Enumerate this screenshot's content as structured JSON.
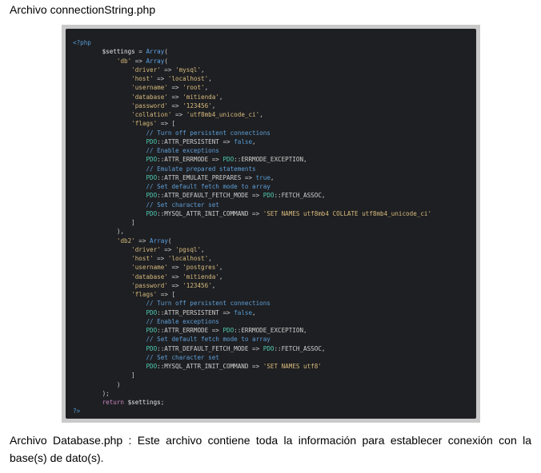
{
  "document": {
    "title": "Archivo connectionString.php",
    "caption": "Archivo Database.php : Este archivo contiene toda la información para establecer conexión con la base(s) de dato(s)."
  },
  "colors": {
    "code_background": "#1e1f22",
    "frame": "#c9c9c9",
    "string": "#d7ba7d",
    "comment": "#5f9fd8",
    "class": "#4ec9b0",
    "keyword": "#569cd6"
  },
  "code_lines": [
    [
      [
        "tag",
        "<?php"
      ]
    ],
    [
      [
        "pl",
        "        "
      ],
      [
        "var",
        "$settings"
      ],
      [
        "pl",
        " = "
      ],
      [
        "fn",
        "Array"
      ],
      [
        "pl",
        "("
      ]
    ],
    [
      [
        "pl",
        "            "
      ],
      [
        "str",
        "'db'"
      ],
      [
        "pl",
        " => "
      ],
      [
        "fn",
        "Array"
      ],
      [
        "pl",
        "("
      ]
    ],
    [
      [
        "pl",
        "                "
      ],
      [
        "str",
        "'driver'"
      ],
      [
        "pl",
        " => "
      ],
      [
        "str",
        "'mysql'"
      ],
      [
        "pl",
        ","
      ]
    ],
    [
      [
        "pl",
        "                "
      ],
      [
        "str",
        "'host'"
      ],
      [
        "pl",
        " => "
      ],
      [
        "str",
        "'localhost'"
      ],
      [
        "pl",
        ","
      ]
    ],
    [
      [
        "pl",
        "                "
      ],
      [
        "str",
        "'username'"
      ],
      [
        "pl",
        " => "
      ],
      [
        "str",
        "'root'"
      ],
      [
        "pl",
        ","
      ]
    ],
    [
      [
        "pl",
        "                "
      ],
      [
        "str",
        "'database'"
      ],
      [
        "pl",
        " => "
      ],
      [
        "str",
        "'mitienda'"
      ],
      [
        "pl",
        ","
      ]
    ],
    [
      [
        "pl",
        "                "
      ],
      [
        "str",
        "'password'"
      ],
      [
        "pl",
        " => "
      ],
      [
        "str",
        "'123456'"
      ],
      [
        "pl",
        ","
      ]
    ],
    [
      [
        "pl",
        "                "
      ],
      [
        "str",
        "'collation'"
      ],
      [
        "pl",
        " => "
      ],
      [
        "str",
        "'utf8mb4_unicode_ci'"
      ],
      [
        "pl",
        ","
      ]
    ],
    [
      [
        "pl",
        "                "
      ],
      [
        "str",
        "'flags'"
      ],
      [
        "pl",
        " => ["
      ]
    ],
    [
      [
        "pl",
        "                    "
      ],
      [
        "com",
        "// Turn off persistent connections"
      ]
    ],
    [
      [
        "pl",
        "                    "
      ],
      [
        "cls",
        "PDO"
      ],
      [
        "pl",
        "::ATTR_PERSISTENT => "
      ],
      [
        "bool",
        "false"
      ],
      [
        "pl",
        ","
      ]
    ],
    [
      [
        "pl",
        "                    "
      ],
      [
        "com",
        "// Enable exceptions"
      ]
    ],
    [
      [
        "pl",
        "                    "
      ],
      [
        "cls",
        "PDO"
      ],
      [
        "pl",
        "::ATTR_ERRMODE => "
      ],
      [
        "cls",
        "PDO"
      ],
      [
        "pl",
        "::ERRMODE_EXCEPTION,"
      ]
    ],
    [
      [
        "pl",
        "                    "
      ],
      [
        "com",
        "// Emulate prepared statements"
      ]
    ],
    [
      [
        "pl",
        "                    "
      ],
      [
        "cls",
        "PDO"
      ],
      [
        "pl",
        "::ATTR_EMULATE_PREPARES => "
      ],
      [
        "bool",
        "true"
      ],
      [
        "pl",
        ","
      ]
    ],
    [
      [
        "pl",
        "                    "
      ],
      [
        "com",
        "// Set default fetch mode to array"
      ]
    ],
    [
      [
        "pl",
        "                    "
      ],
      [
        "cls",
        "PDO"
      ],
      [
        "pl",
        "::ATTR_DEFAULT_FETCH_MODE => "
      ],
      [
        "cls",
        "PDO"
      ],
      [
        "pl",
        "::FETCH_ASSOC,"
      ]
    ],
    [
      [
        "pl",
        "                    "
      ],
      [
        "com",
        "// Set character set"
      ]
    ],
    [
      [
        "pl",
        "                    "
      ],
      [
        "cls",
        "PDO"
      ],
      [
        "pl",
        "::MYSQL_ATTR_INIT_COMMAND => "
      ],
      [
        "str",
        "'SET NAMES utf8mb4 COLLATE utf8mb4_unicode_ci'"
      ]
    ],
    [
      [
        "pl",
        "                ]"
      ]
    ],
    [
      [
        "pl",
        "            ),"
      ]
    ],
    [
      [
        "pl",
        "            "
      ],
      [
        "str",
        "'db2'"
      ],
      [
        "pl",
        " => "
      ],
      [
        "fn",
        "Array"
      ],
      [
        "pl",
        "("
      ]
    ],
    [
      [
        "pl",
        "                "
      ],
      [
        "str",
        "'driver'"
      ],
      [
        "pl",
        " => "
      ],
      [
        "str",
        "'pgsql'"
      ],
      [
        "pl",
        ","
      ]
    ],
    [
      [
        "pl",
        "                "
      ],
      [
        "str",
        "'host'"
      ],
      [
        "pl",
        " => "
      ],
      [
        "str",
        "'localhost'"
      ],
      [
        "pl",
        ","
      ]
    ],
    [
      [
        "pl",
        "                "
      ],
      [
        "str",
        "'username'"
      ],
      [
        "pl",
        " => "
      ],
      [
        "str",
        "'postgres'"
      ],
      [
        "pl",
        ","
      ]
    ],
    [
      [
        "pl",
        "                "
      ],
      [
        "str",
        "'database'"
      ],
      [
        "pl",
        " => "
      ],
      [
        "str",
        "'mitienda'"
      ],
      [
        "pl",
        ","
      ]
    ],
    [
      [
        "pl",
        "                "
      ],
      [
        "str",
        "'password'"
      ],
      [
        "pl",
        " => "
      ],
      [
        "str",
        "'123456'"
      ],
      [
        "pl",
        ","
      ]
    ],
    [
      [
        "pl",
        "                "
      ],
      [
        "str",
        "'flags'"
      ],
      [
        "pl",
        " => ["
      ]
    ],
    [
      [
        "pl",
        "                    "
      ],
      [
        "com",
        "// Turn off persistent connections"
      ]
    ],
    [
      [
        "pl",
        "                    "
      ],
      [
        "cls",
        "PDO"
      ],
      [
        "pl",
        "::ATTR_PERSISTENT => "
      ],
      [
        "bool",
        "false"
      ],
      [
        "pl",
        ","
      ]
    ],
    [
      [
        "pl",
        "                    "
      ],
      [
        "com",
        "// Enable exceptions"
      ]
    ],
    [
      [
        "pl",
        "                    "
      ],
      [
        "cls",
        "PDO"
      ],
      [
        "pl",
        "::ATTR_ERRMODE => "
      ],
      [
        "cls",
        "PDO"
      ],
      [
        "pl",
        "::ERRMODE_EXCEPTION,"
      ]
    ],
    [
      [
        "pl",
        "                    "
      ],
      [
        "com",
        "// Set default fetch mode to array"
      ]
    ],
    [
      [
        "pl",
        "                    "
      ],
      [
        "cls",
        "PDO"
      ],
      [
        "pl",
        "::ATTR_DEFAULT_FETCH_MODE => "
      ],
      [
        "cls",
        "PDO"
      ],
      [
        "pl",
        "::FETCH_ASSOC,"
      ]
    ],
    [
      [
        "pl",
        "                    "
      ],
      [
        "com",
        "// Set character set"
      ]
    ],
    [
      [
        "pl",
        "                    "
      ],
      [
        "cls",
        "PDO"
      ],
      [
        "pl",
        "::MYSQL_ATTR_INIT_COMMAND => "
      ],
      [
        "str",
        "'SET NAMES utf8'"
      ]
    ],
    [
      [
        "pl",
        "                ]"
      ]
    ],
    [
      [
        "pl",
        "            )"
      ]
    ],
    [
      [
        "pl",
        "        );"
      ]
    ],
    [
      [
        "pl",
        "        "
      ],
      [
        "ret",
        "return"
      ],
      [
        "pl",
        " "
      ],
      [
        "var",
        "$settings"
      ],
      [
        "pl",
        ";"
      ]
    ],
    [
      [
        "tag",
        "?>"
      ]
    ]
  ]
}
